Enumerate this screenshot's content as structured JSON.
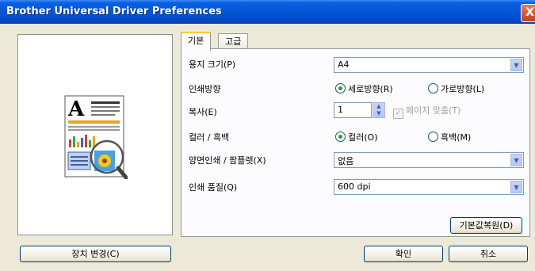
{
  "window": {
    "title": "Brother Universal Driver Preferences",
    "close_glyph": "X"
  },
  "tabs": [
    {
      "label": "기본"
    },
    {
      "label": "고급"
    }
  ],
  "paper_size": {
    "label": "용지 크기(P)",
    "value": "A4"
  },
  "orientation": {
    "label": "인쇄방향",
    "options": [
      {
        "label": "세로방향(R)",
        "selected": true
      },
      {
        "label": "가로방향(L)",
        "selected": false
      }
    ]
  },
  "copies": {
    "label": "복사(E)",
    "value": "1",
    "collate_label": "페이지 맞춤(T)",
    "collate_checked": true,
    "collate_enabled": false
  },
  "color": {
    "label": "컬러 / 흑백",
    "options": [
      {
        "label": "컬러(O)",
        "selected": true
      },
      {
        "label": "흑백(M)",
        "selected": false
      }
    ]
  },
  "duplex": {
    "label": "양면인쇄 / 팜플렛(X)",
    "value": "없음"
  },
  "quality": {
    "label": "인쇄 품질(Q)",
    "value": "600 dpi"
  },
  "buttons": {
    "default": "기본값복원(D)",
    "change_device": "장치 변경(C)",
    "ok": "확인",
    "cancel": "취소"
  },
  "colors": {
    "titlebar": "#0556d6",
    "panel": "#fcfcfe",
    "dialog": "#ece9d8"
  }
}
